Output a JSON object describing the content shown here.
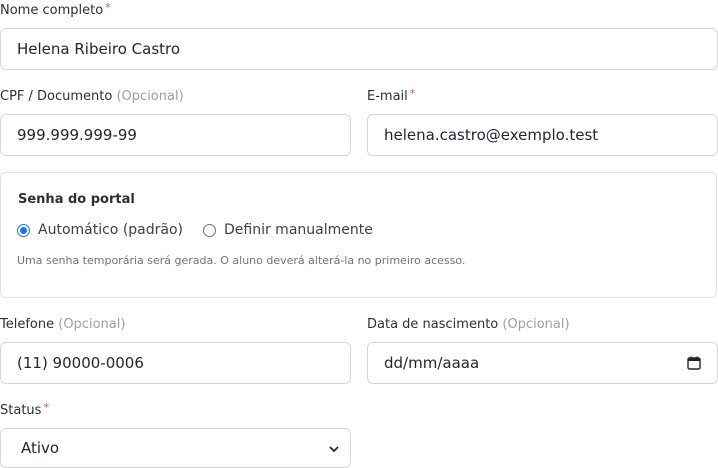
{
  "fields": {
    "nome": {
      "label": "Nome completo",
      "required": "*",
      "value": "Helena Ribeiro Castro"
    },
    "cpf": {
      "label": "CPF / Documento",
      "optional": "(Opcional)",
      "value": "999.999.999-99"
    },
    "email": {
      "label": "E-mail",
      "required": "*",
      "value": "helena.castro@exemplo.test"
    },
    "telefone": {
      "label": "Telefone",
      "optional": "(Opcional)",
      "value": "(11) 90000-0006"
    },
    "nascimento": {
      "label": "Data de nascimento",
      "optional": "(Opcional)",
      "placeholder": "dd/mm/aaaa"
    },
    "status": {
      "label": "Status",
      "required": "*",
      "value": "Ativo"
    }
  },
  "senha": {
    "title": "Senha do portal",
    "option_auto": "Automático (padrão)",
    "option_manual": "Definir manualmente",
    "hint": "Uma senha temporária será gerada. O aluno deverá alterá-la no primeiro acesso."
  },
  "colors": {
    "accent": "#1a73e8",
    "required": "#e5484d",
    "border": "#d4d7dd"
  }
}
